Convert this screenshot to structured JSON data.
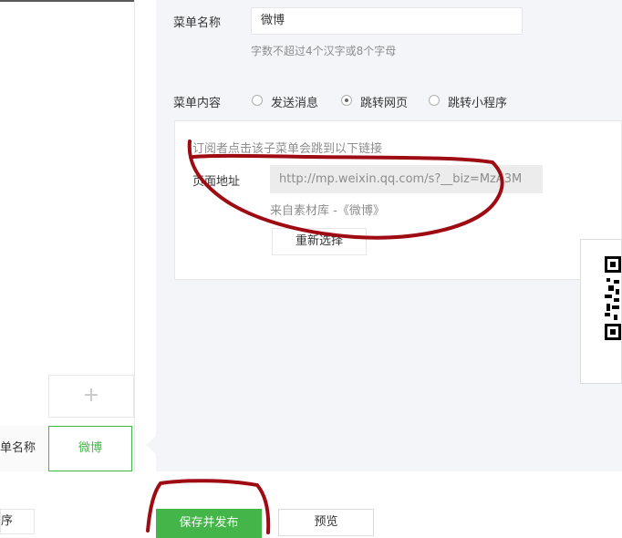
{
  "form": {
    "name_label": "菜单名称",
    "name_value": "微博",
    "name_hint": "字数不超过4个汉字或8个字母",
    "content_label": "菜单内容",
    "options": [
      {
        "label": "发送消息",
        "checked": false
      },
      {
        "label": "跳转网页",
        "checked": true
      },
      {
        "label": "跳转小程序",
        "checked": false
      }
    ],
    "link_intro": "订阅者点击该子菜单会跳到以下链接",
    "url_label": "页面地址",
    "url_value": "http://mp.weixin.qq.com/s?__biz=MzA3M",
    "source": "来自素材库 -《微博》",
    "reselect": "重新选择"
  },
  "preview": {
    "add": "+",
    "name_slot": "单名称",
    "active_item": "微博"
  },
  "toolbar": {
    "left_stub": "序",
    "save": "保存并发布",
    "preview": "预览"
  },
  "colors": {
    "accent": "#44b549",
    "annotation": "#9e0b12",
    "panel": "#f4f5f9"
  }
}
